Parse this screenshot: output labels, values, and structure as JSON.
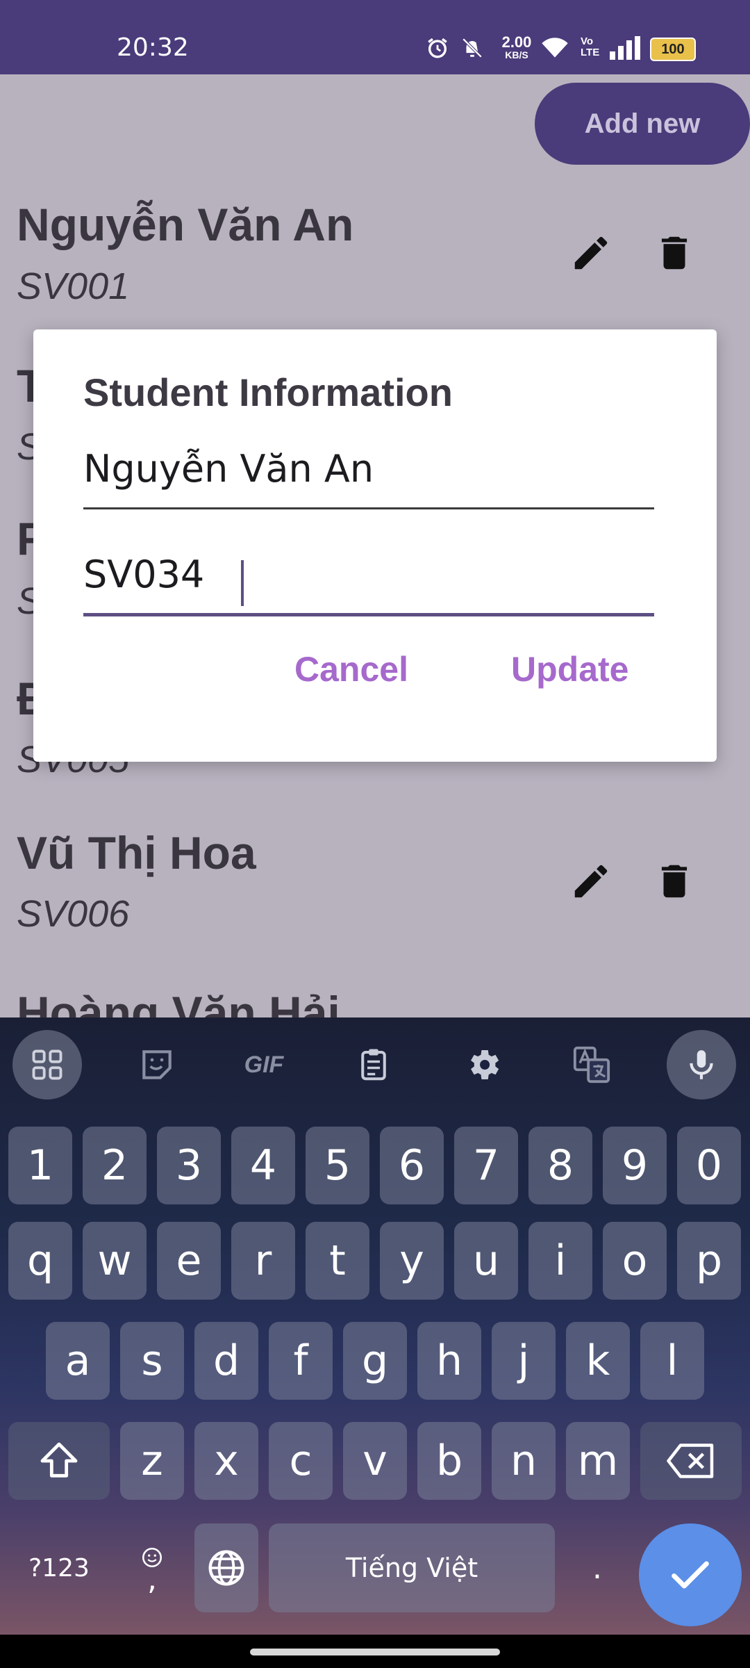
{
  "status_bar": {
    "time": "20:32",
    "speed_value": "2.00",
    "speed_unit": "KB/S",
    "network": "Vo LTE",
    "battery": "100"
  },
  "list": {
    "add_new_label": "Add new",
    "rows": [
      {
        "name": "Nguyễn Văn An",
        "id": "SV001"
      },
      {
        "name": "T",
        "id": "S"
      },
      {
        "name": "F",
        "id": "S"
      },
      {
        "name": "Đ",
        "id": "SV005"
      },
      {
        "name": "Vũ Thị Hoa",
        "id": "SV006"
      },
      {
        "name": "Hoàng Văn Hải",
        "id": ""
      }
    ]
  },
  "dialog": {
    "title": "Student Information",
    "name_value": "Nguyễn Văn An",
    "id_value": "SV034",
    "cancel_label": "Cancel",
    "update_label": "Update"
  },
  "keyboard": {
    "toolbar": [
      "apps-grid-icon",
      "sticker-icon",
      "GIF",
      "clipboard-icon",
      "settings-icon",
      "translate-icon",
      "mic-icon"
    ],
    "gif_label": "GIF",
    "row_numbers": [
      "1",
      "2",
      "3",
      "4",
      "5",
      "6",
      "7",
      "8",
      "9",
      "0"
    ],
    "row1": [
      "q",
      "w",
      "e",
      "r",
      "t",
      "y",
      "u",
      "i",
      "o",
      "p"
    ],
    "row2": [
      "a",
      "s",
      "d",
      "f",
      "g",
      "h",
      "j",
      "k",
      "l"
    ],
    "row3": [
      "z",
      "x",
      "c",
      "v",
      "b",
      "n",
      "m"
    ],
    "symbols_label": "?123",
    "comma_label": ",",
    "space_label": "Tiếng Việt",
    "period_label": "."
  },
  "colors": {
    "primary_dark": "#4a3b7a",
    "dialog_button": "#a669cc",
    "enter_key": "#5b8fe8"
  }
}
